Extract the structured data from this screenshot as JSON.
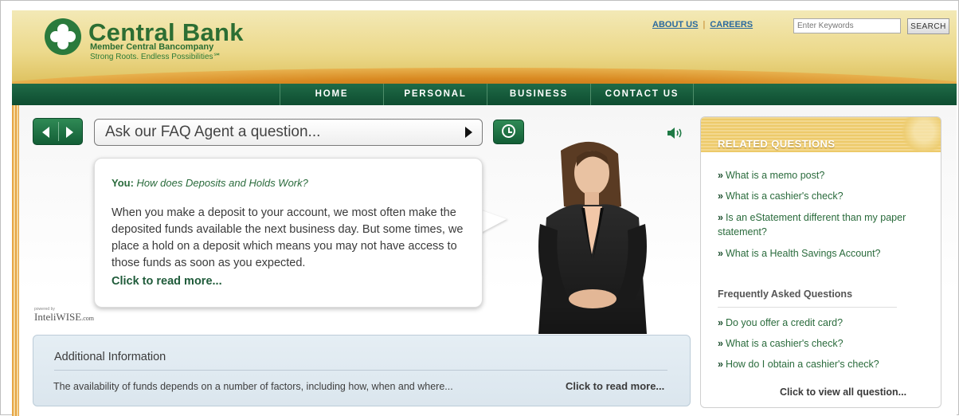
{
  "header": {
    "bank_name": "Central Bank",
    "member_line": "Member Central Bancompany",
    "tagline": "Strong Roots. Endless Possibilities℠",
    "links": {
      "about": "ABOUT US",
      "separator": "|",
      "careers": "CAREERS"
    },
    "search": {
      "placeholder": "Enter Keywords",
      "button_label": "SEARCH"
    }
  },
  "nav": {
    "items": [
      {
        "label": "HOME"
      },
      {
        "label": "PERSONAL"
      },
      {
        "label": "BUSINESS"
      },
      {
        "label": "CONTACT US"
      }
    ]
  },
  "faq_agent": {
    "input_value": "Ask our FAQ Agent a question...",
    "bubble": {
      "you_label": "You:",
      "question": "How does Deposits and Holds Work?",
      "answer": "When you make a deposit to your account, we most often make the deposited funds available the next business day. But some times, we place a hold on a deposit which means you may not have access to those funds as soon as you expected.",
      "read_more": "Click to read more..."
    },
    "powered_by": "powered by",
    "brand": "InteliWISE",
    "brand_domain": ".com"
  },
  "additional_info": {
    "title": "Additional Information",
    "text": "The availability of funds depends on a number of factors, including how, when and where...",
    "read_more": "Click to read more..."
  },
  "related": {
    "title": "RELATED QUESTIONS",
    "questions": [
      {
        "chevron": "»",
        "text": "What is a memo post?"
      },
      {
        "chevron": "»",
        "text": "What is a cashier's check?"
      },
      {
        "chevron": "»",
        "text": "Is an eStatement different than my paper statement?"
      },
      {
        "chevron": "»",
        "text": "What is a Health Savings Account?"
      }
    ],
    "faq_title": "Frequently Asked Questions",
    "faq": [
      {
        "chevron": "»",
        "text": "Do you offer a credit card?"
      },
      {
        "chevron": "»",
        "text": "What is a cashier's check?"
      },
      {
        "chevron": "»",
        "text": "How do I obtain a cashier's check?"
      }
    ],
    "view_all": "Click to view all question..."
  },
  "icons": {
    "prev": "chevron-left-icon",
    "next": "chevron-right-icon",
    "submit": "play-icon",
    "history": "clock-icon",
    "sound": "speaker-icon",
    "logo": "clover-logo-icon"
  },
  "colors": {
    "brand_green": "#2c6e33",
    "nav_green": "#0e4c30",
    "header_gold": "#ecd98b",
    "link_blue": "#2b6a9e"
  }
}
